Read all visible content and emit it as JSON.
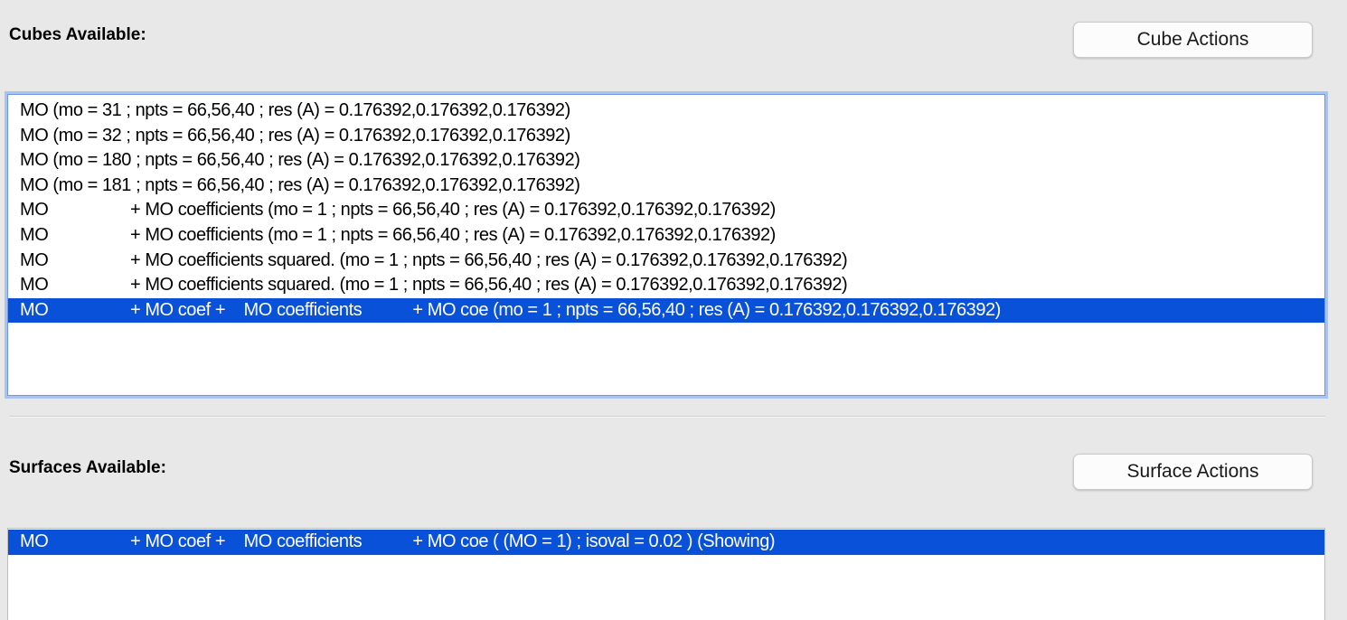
{
  "cubes": {
    "label": "Cubes Available:",
    "action_button": "Cube Actions",
    "items": [
      {
        "name": "MO (mo = 31 ; npts = 66,56,40 ; res (A) = 0.176392,0.176392,0.176392)",
        "detail": ""
      },
      {
        "name": "MO (mo = 32 ; npts = 66,56,40 ; res (A) = 0.176392,0.176392,0.176392)",
        "detail": ""
      },
      {
        "name": "MO (mo = 180 ; npts = 66,56,40 ; res (A) = 0.176392,0.176392,0.176392)",
        "detail": ""
      },
      {
        "name": "MO (mo = 181 ; npts = 66,56,40 ; res (A) = 0.176392,0.176392,0.176392)",
        "detail": ""
      },
      {
        "name": "MO",
        "detail": "+ MO coefficients (mo = 1 ; npts = 66,56,40 ; res (A) = 0.176392,0.176392,0.176392)"
      },
      {
        "name": "MO",
        "detail": "+ MO coefficients (mo = 1 ; npts = 66,56,40 ; res (A) = 0.176392,0.176392,0.176392)"
      },
      {
        "name": "MO",
        "detail": "+ MO coefficients squared. (mo = 1 ; npts = 66,56,40 ; res (A) = 0.176392,0.176392,0.176392)"
      },
      {
        "name": "MO",
        "detail": "+ MO coefficients squared. (mo = 1 ; npts = 66,56,40 ; res (A) = 0.176392,0.176392,0.176392)"
      },
      {
        "name": "MO",
        "detail": "+ MO coef +    MO coefficients           + MO coe (mo = 1 ; npts = 66,56,40 ; res (A) = 0.176392,0.176392,0.176392)"
      }
    ],
    "selected_index": 8
  },
  "surfaces": {
    "label": "Surfaces Available:",
    "action_button": "Surface Actions",
    "items": [
      {
        "name": "MO",
        "detail": "+ MO coef +    MO coefficients           + MO coe ( (MO = 1) ; isoval = 0.02 ) (Showing)"
      }
    ],
    "selected_index": 0
  },
  "colors": {
    "selection": "#0a51d9",
    "focus_ring": "#a9c2f0",
    "background": "#e8e8e8"
  }
}
